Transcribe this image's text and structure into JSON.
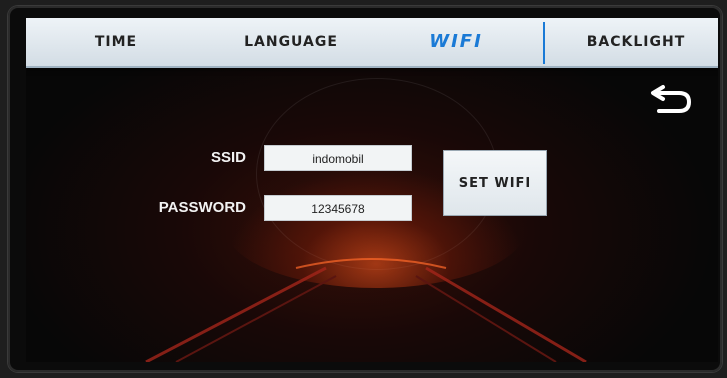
{
  "tabs": [
    {
      "label": "TIME"
    },
    {
      "label": "LANGUAGE"
    },
    {
      "label": "WIFI"
    },
    {
      "label": "BACKLIGHT"
    }
  ],
  "active_tab": "WIFI",
  "form": {
    "ssid_label": "SSID",
    "ssid_value": "indomobil",
    "password_label": "PASSWORD",
    "password_value": "12345678",
    "set_button_label": "SET WIFI"
  },
  "icons": {
    "back": "return-arrow-icon"
  },
  "colors": {
    "active_tab": "#1a7ad6",
    "tab_bar": "#e3eaf0",
    "screen_bg": "#070707",
    "glow": "#ff5a1e"
  }
}
